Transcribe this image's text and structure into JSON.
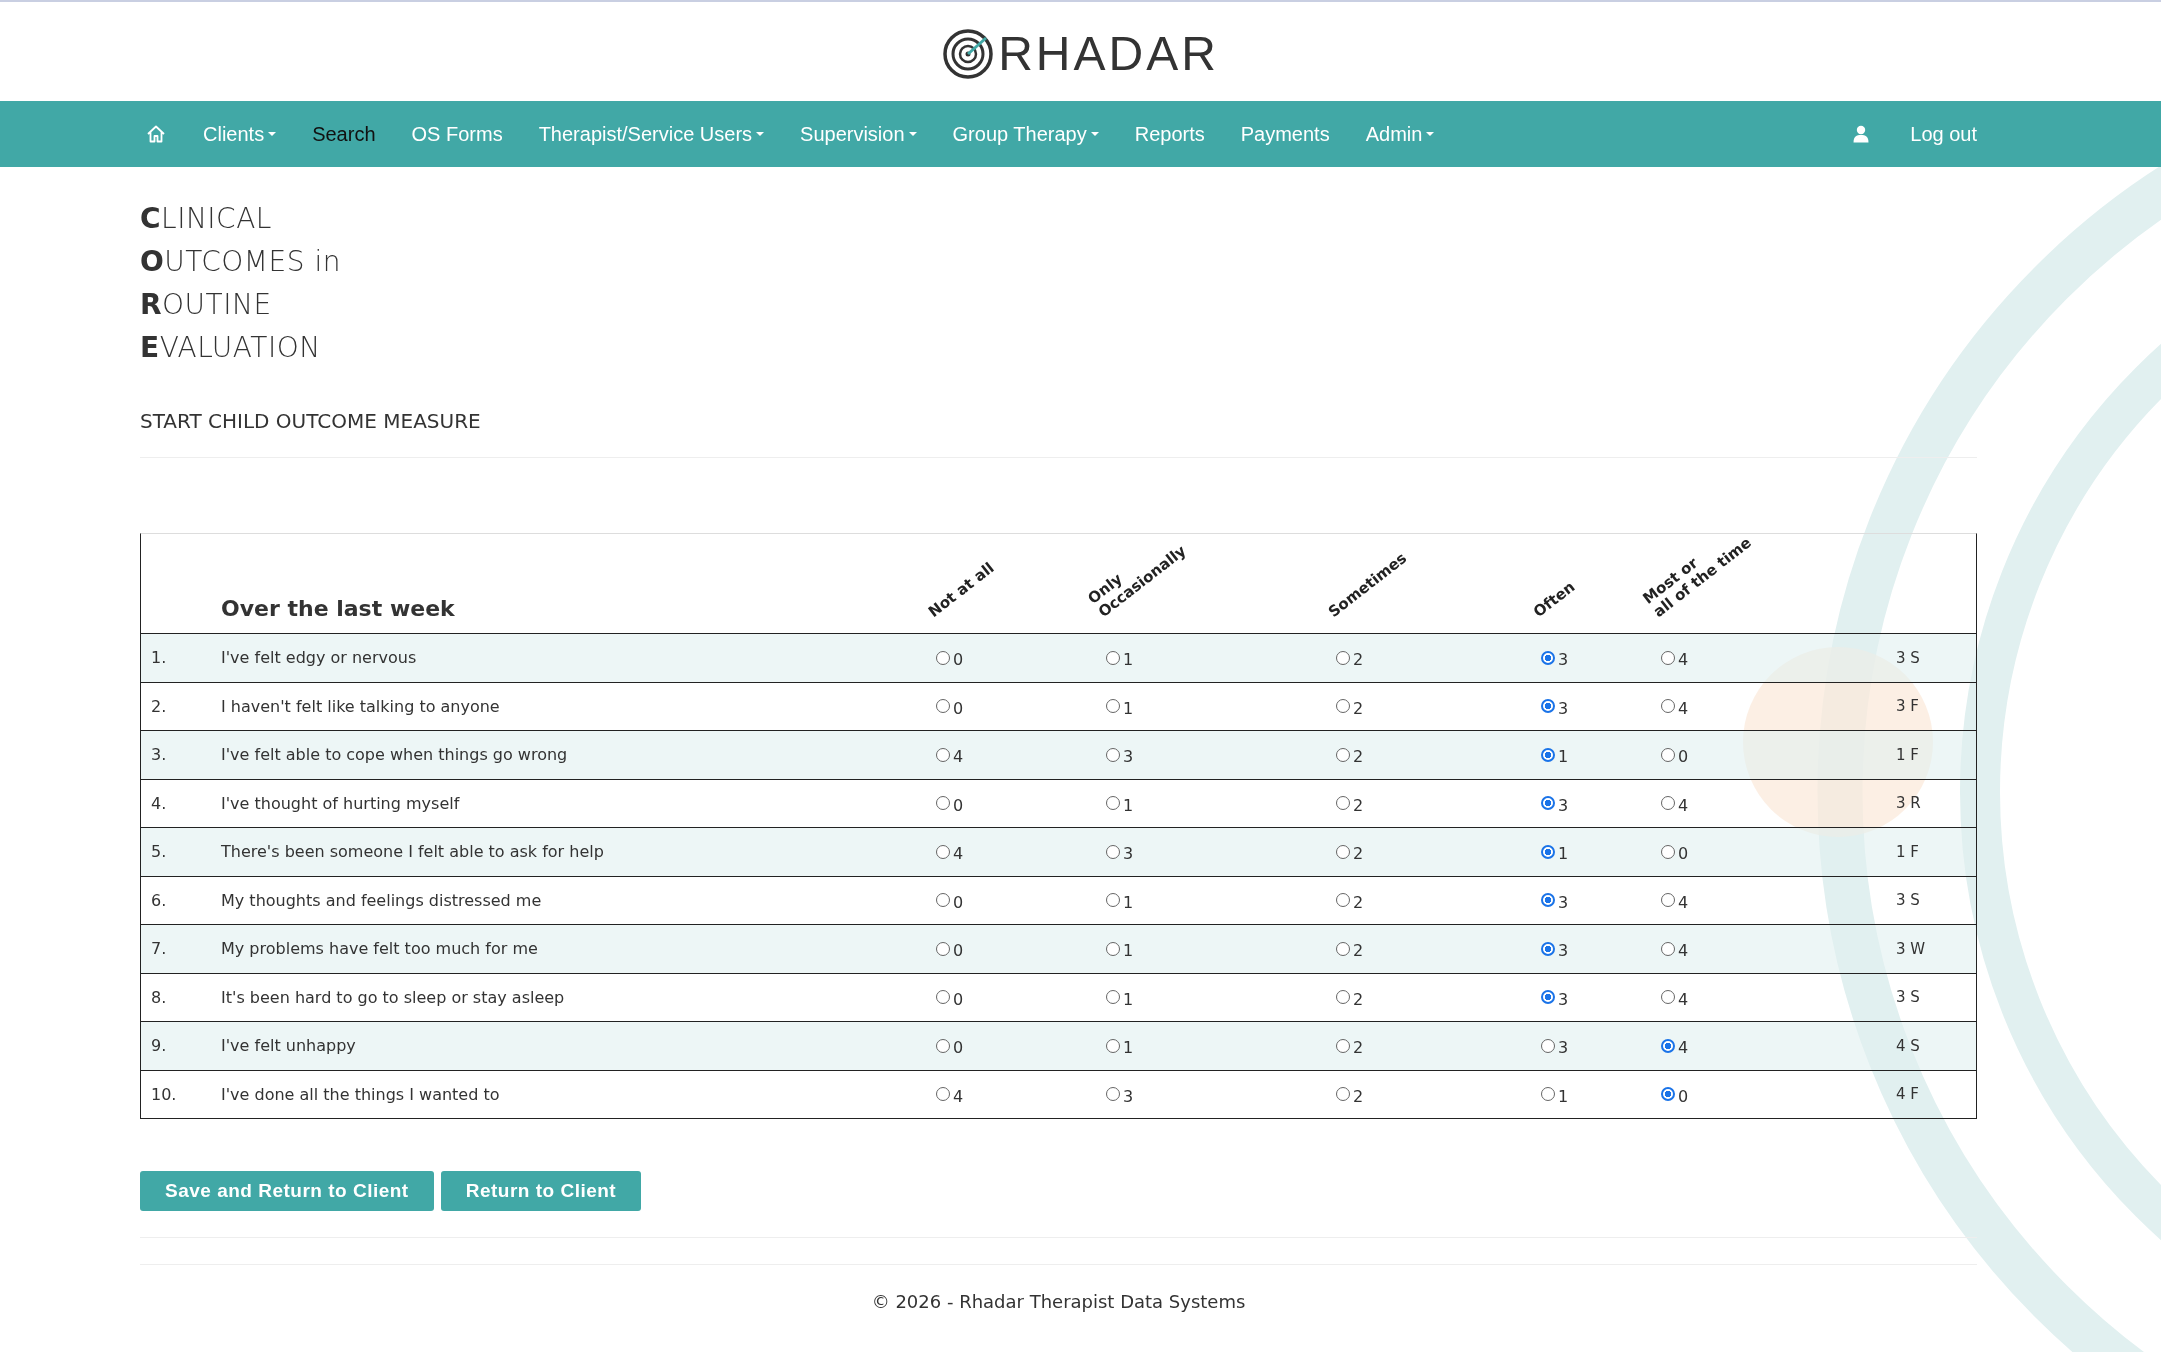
{
  "logo": {
    "text": "RHADAR"
  },
  "nav": {
    "items": [
      {
        "label": "Clients",
        "caret": true,
        "selected": false
      },
      {
        "label": "Search",
        "caret": false,
        "selected": true
      },
      {
        "label": "OS Forms",
        "caret": false,
        "selected": false
      },
      {
        "label": "Therapist/Service Users",
        "caret": true,
        "selected": false
      },
      {
        "label": "Supervision",
        "caret": true,
        "selected": false
      },
      {
        "label": "Group Therapy",
        "caret": true,
        "selected": false
      },
      {
        "label": "Reports",
        "caret": false,
        "selected": false
      },
      {
        "label": "Payments",
        "caret": false,
        "selected": false
      },
      {
        "label": "Admin",
        "caret": true,
        "selected": false
      }
    ],
    "logout": "Log out"
  },
  "title_lines": [
    "**C**LINICAL",
    "**O**UTCOMES in",
    "**R**OUTINE",
    "**E**VALUATION"
  ],
  "subtitle": "START CHILD OUTCOME MEASURE",
  "table": {
    "heading": "Over the last week",
    "columns": [
      "Not at all",
      "Only\nOccasionally",
      "Sometimes",
      "Often",
      "Most or\nall of the time"
    ],
    "rows": [
      {
        "number": "1.",
        "question": "I've felt edgy or nervous",
        "options": [
          {
            "label": "0",
            "selected": false
          },
          {
            "label": "1",
            "selected": false
          },
          {
            "label": "2",
            "selected": false
          },
          {
            "label": "3",
            "selected": true
          },
          {
            "label": "4",
            "selected": false
          }
        ],
        "score": "3 S"
      },
      {
        "number": "2.",
        "question": "I haven't felt like talking to anyone",
        "options": [
          {
            "label": "0",
            "selected": false
          },
          {
            "label": "1",
            "selected": false
          },
          {
            "label": "2",
            "selected": false
          },
          {
            "label": "3",
            "selected": true
          },
          {
            "label": "4",
            "selected": false
          }
        ],
        "score": "3 F"
      },
      {
        "number": "3.",
        "question": "I've felt able to cope when things go wrong",
        "options": [
          {
            "label": "4",
            "selected": false
          },
          {
            "label": "3",
            "selected": false
          },
          {
            "label": "2",
            "selected": false
          },
          {
            "label": "1",
            "selected": true
          },
          {
            "label": "0",
            "selected": false
          }
        ],
        "score": "1 F"
      },
      {
        "number": "4.",
        "question": "I've thought of hurting myself",
        "options": [
          {
            "label": "0",
            "selected": false
          },
          {
            "label": "1",
            "selected": false
          },
          {
            "label": "2",
            "selected": false
          },
          {
            "label": "3",
            "selected": true
          },
          {
            "label": "4",
            "selected": false
          }
        ],
        "score": "3 R"
      },
      {
        "number": "5.",
        "question": "There's been someone I felt able to ask for help",
        "options": [
          {
            "label": "4",
            "selected": false
          },
          {
            "label": "3",
            "selected": false
          },
          {
            "label": "2",
            "selected": false
          },
          {
            "label": "1",
            "selected": true
          },
          {
            "label": "0",
            "selected": false
          }
        ],
        "score": "1 F"
      },
      {
        "number": "6.",
        "question": "My thoughts and feelings distressed me",
        "options": [
          {
            "label": "0",
            "selected": false
          },
          {
            "label": "1",
            "selected": false
          },
          {
            "label": "2",
            "selected": false
          },
          {
            "label": "3",
            "selected": true
          },
          {
            "label": "4",
            "selected": false
          }
        ],
        "score": "3 S"
      },
      {
        "number": "7.",
        "question": "My problems have felt too much for me",
        "options": [
          {
            "label": "0",
            "selected": false
          },
          {
            "label": "1",
            "selected": false
          },
          {
            "label": "2",
            "selected": false
          },
          {
            "label": "3",
            "selected": true
          },
          {
            "label": "4",
            "selected": false
          }
        ],
        "score": "3 W"
      },
      {
        "number": "8.",
        "question": "It's been hard to go to sleep or stay asleep",
        "options": [
          {
            "label": "0",
            "selected": false
          },
          {
            "label": "1",
            "selected": false
          },
          {
            "label": "2",
            "selected": false
          },
          {
            "label": "3",
            "selected": true
          },
          {
            "label": "4",
            "selected": false
          }
        ],
        "score": "3 S"
      },
      {
        "number": "9.",
        "question": "I've felt unhappy",
        "options": [
          {
            "label": "0",
            "selected": false
          },
          {
            "label": "1",
            "selected": false
          },
          {
            "label": "2",
            "selected": false
          },
          {
            "label": "3",
            "selected": false
          },
          {
            "label": "4",
            "selected": true
          }
        ],
        "score": "4 S"
      },
      {
        "number": "10.",
        "question": "I've done all the things I wanted to",
        "options": [
          {
            "label": "4",
            "selected": false
          },
          {
            "label": "3",
            "selected": false
          },
          {
            "label": "2",
            "selected": false
          },
          {
            "label": "1",
            "selected": false
          },
          {
            "label": "0",
            "selected": true
          }
        ],
        "score": "4 F"
      }
    ]
  },
  "buttons": [
    "Save and Return to Client",
    "Return to Client"
  ],
  "footer": "© 2026 - Rhadar Therapist Data Systems"
}
